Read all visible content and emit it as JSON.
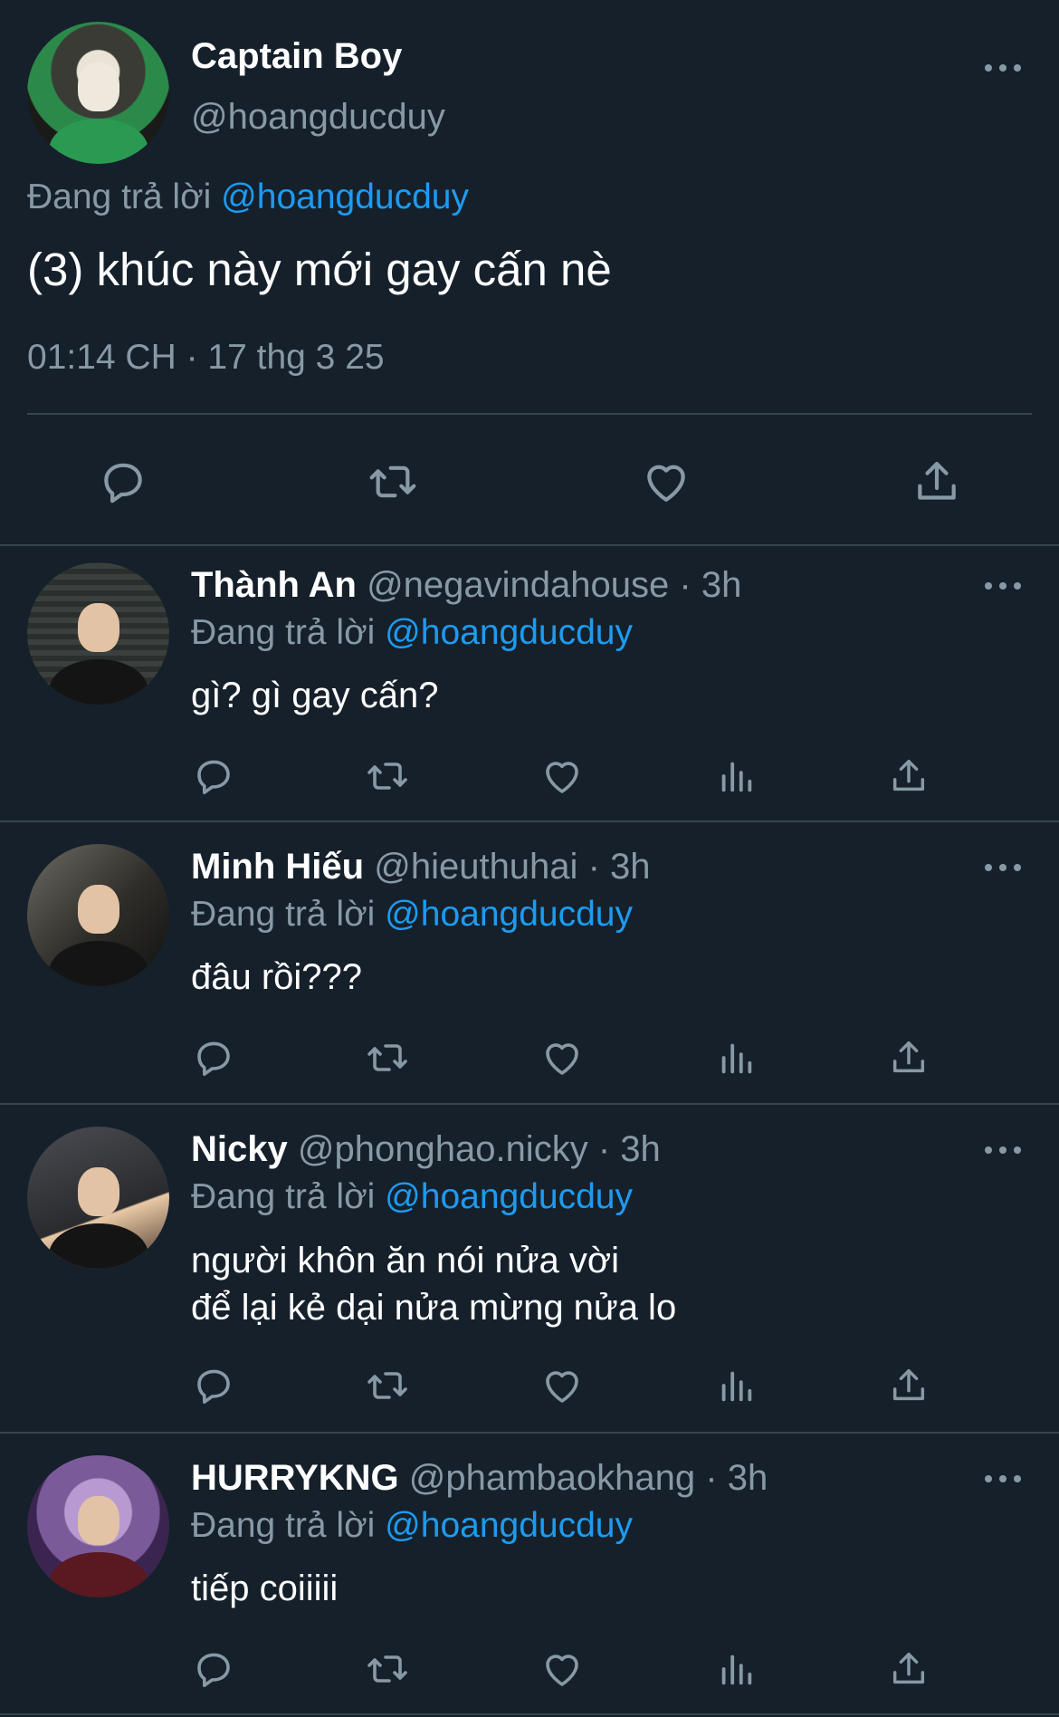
{
  "main_tweet": {
    "name": "Captain Boy",
    "handle": "@hoangducduy",
    "reply_prefix": "Đang trả lời",
    "reply_to": "@hoangducduy",
    "text": "(3) khúc này mới gay cấn nè",
    "timestamp": "01:14 CH · 17 thg 3 25",
    "actions": [
      "reply-icon",
      "retweet-icon",
      "like-icon",
      "share-icon"
    ]
  },
  "replies": [
    {
      "name": "Thành An",
      "handle": "@negavindahouse",
      "time": "· 3h",
      "reply_prefix": "Đang trả lời",
      "reply_to": "@hoangducduy",
      "text_lines": [
        "gì? gì gay cấn?"
      ]
    },
    {
      "name": "Minh Hiếu",
      "handle": "@hieuthuhai",
      "time": "· 3h",
      "reply_prefix": "Đang trả lời",
      "reply_to": "@hoangducduy",
      "text_lines": [
        "đâu rồi???"
      ]
    },
    {
      "name": "Nicky",
      "handle": "@phonghao.nicky",
      "time": "· 3h",
      "reply_prefix": "Đang trả lời",
      "reply_to": "@hoangducduy",
      "text_lines": [
        "người khôn ăn nói nửa vời",
        "để lại kẻ dại nửa mừng nửa lo"
      ]
    },
    {
      "name": "HURRYKNG",
      "handle": "@phambaokhang",
      "time": "· 3h",
      "reply_prefix": "Đang trả lời",
      "reply_to": "@hoangducduy",
      "text_lines": [
        "tiếp coiiiii"
      ]
    }
  ],
  "reply_actions": [
    "reply-icon",
    "retweet-icon",
    "like-icon",
    "views-icon",
    "share-icon"
  ],
  "colors": {
    "background": "#15202b",
    "text": "#ffffff",
    "secondary": "#8899a6",
    "mention": "#1d9bf0",
    "divider": "#38444d"
  }
}
